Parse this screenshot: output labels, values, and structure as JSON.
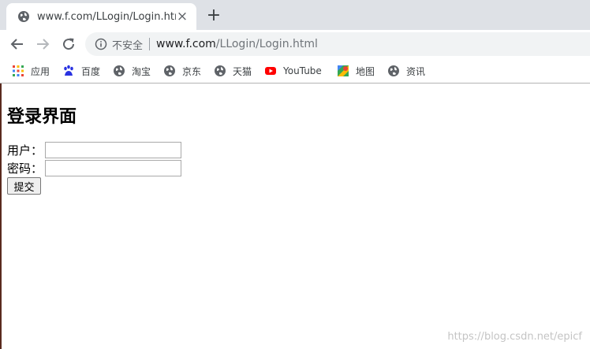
{
  "browser": {
    "tab": {
      "title": "www.f.com/LLogin/Login.html",
      "close": "×"
    },
    "new_tab": "+",
    "omnibox": {
      "security_label": "不安全",
      "url_host": "www.f.com",
      "url_path": "/LLogin/Login.html"
    },
    "bookmarks": [
      {
        "label": "应用",
        "icon": "apps-grid-icon"
      },
      {
        "label": "百度",
        "icon": "baidu-paw-icon"
      },
      {
        "label": "淘宝",
        "icon": "globe-icon"
      },
      {
        "label": "京东",
        "icon": "globe-icon"
      },
      {
        "label": "天猫",
        "icon": "globe-icon"
      },
      {
        "label": "YouTube",
        "icon": "youtube-icon"
      },
      {
        "label": "地图",
        "icon": "maps-pin-icon"
      },
      {
        "label": "资讯",
        "icon": "globe-icon"
      }
    ]
  },
  "page": {
    "heading": "登录界面",
    "user_label": "用户：",
    "user_value": "",
    "password_label": "密码：",
    "password_value": "",
    "submit_label": "提交"
  },
  "watermark": "https://blog.csdn.net/epicf"
}
